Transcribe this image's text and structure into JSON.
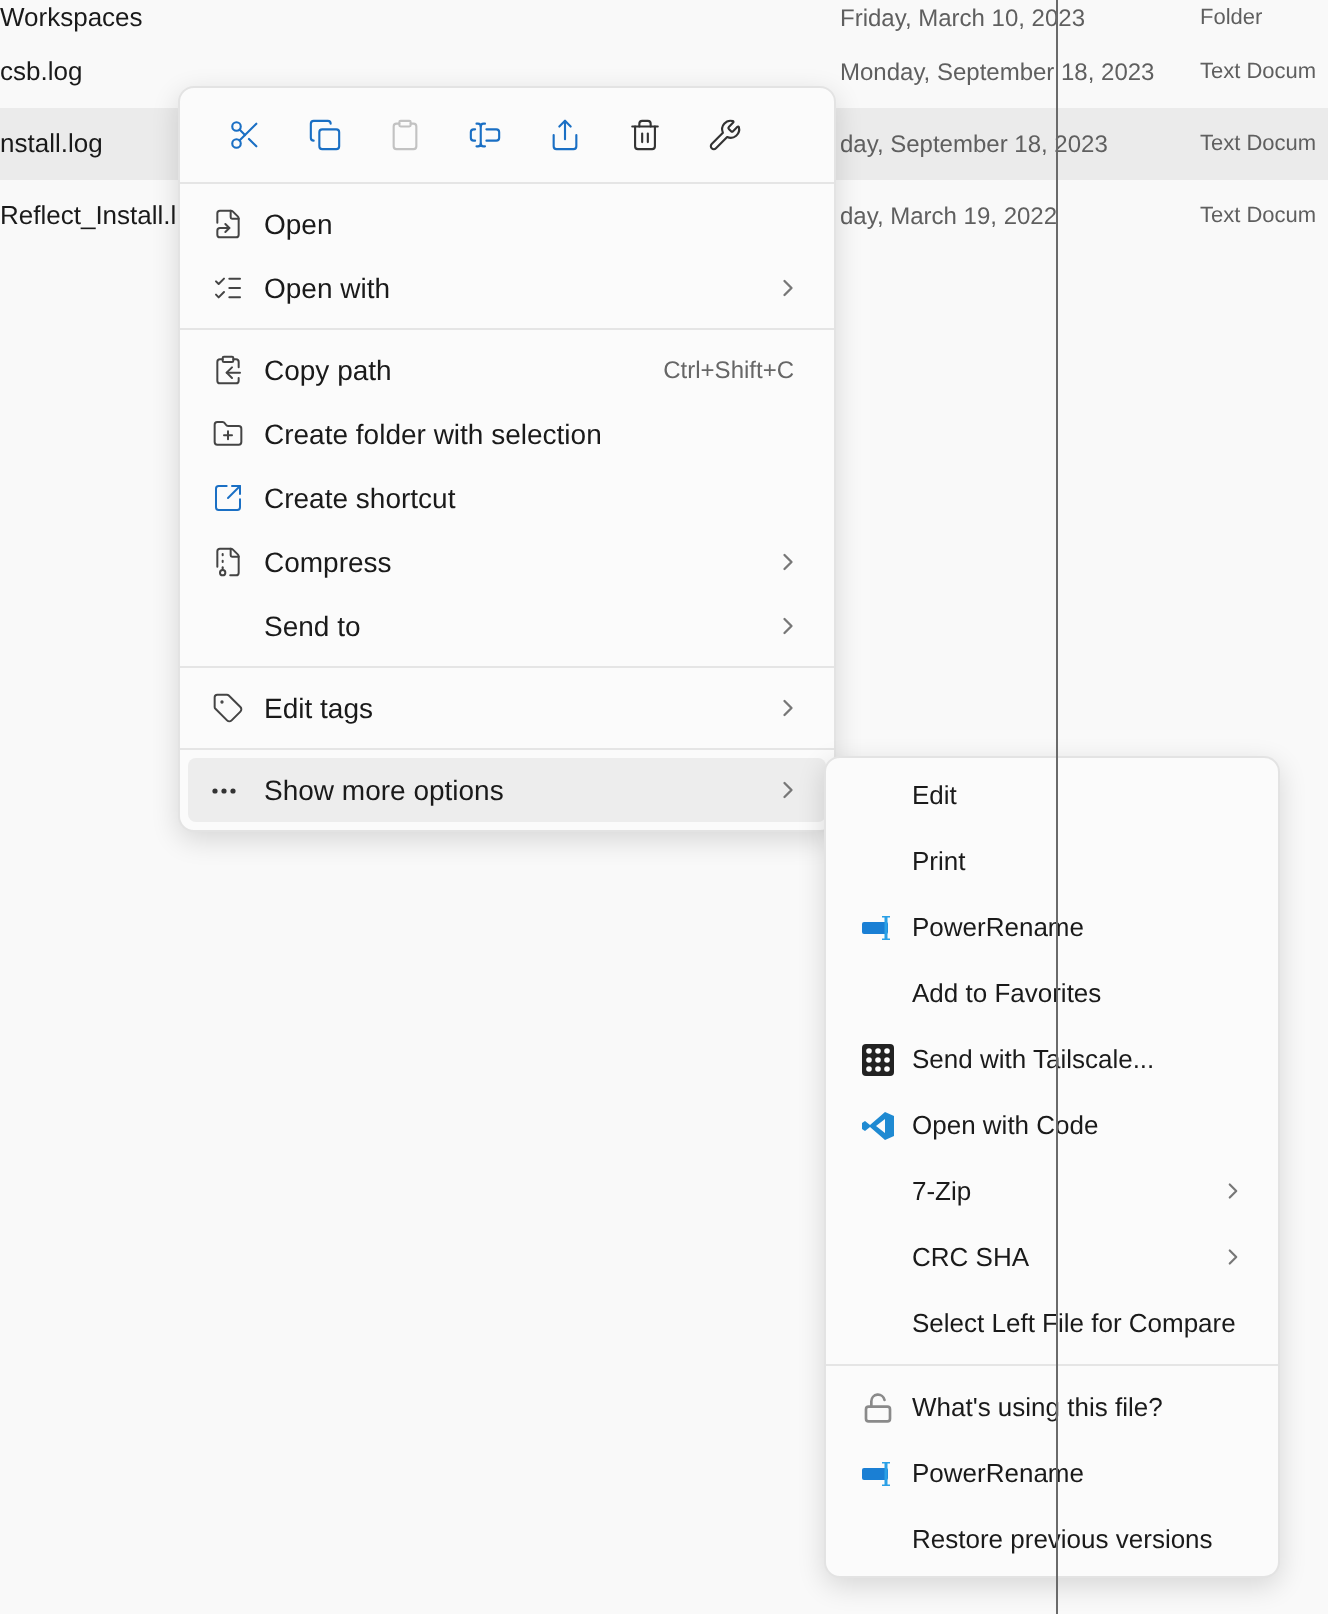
{
  "files": [
    {
      "name": "Workspaces",
      "date": "Friday, March 10, 2023",
      "type": "Folder",
      "selected": false
    },
    {
      "name": "csb.log",
      "date": "Monday, September 18, 2023",
      "type": "Text Docum",
      "selected": false
    },
    {
      "name": "nstall.log",
      "date": "day, September 18, 2023",
      "type": "Text Docum",
      "selected": true
    },
    {
      "name": "Reflect_Install.l",
      "date": "day, March 19, 2022",
      "type": "Text Docum",
      "selected": false
    }
  ],
  "context_menu": {
    "toolbar": [
      {
        "disabled": false
      },
      {
        "disabled": false
      },
      {
        "disabled": true
      },
      {
        "disabled": false
      },
      {
        "disabled": false
      },
      {
        "disabled": false
      },
      {
        "disabled": false
      }
    ],
    "items": [
      {
        "kind": "item",
        "label": "Open",
        "submenu": false,
        "selected": false
      },
      {
        "kind": "item",
        "label": "Open with",
        "submenu": true,
        "selected": false
      },
      {
        "kind": "separator"
      },
      {
        "kind": "item",
        "label": "Copy path",
        "shortcut": "Ctrl+Shift+C",
        "submenu": false,
        "selected": false
      },
      {
        "kind": "item",
        "label": "Create folder with selection",
        "submenu": false,
        "selected": false
      },
      {
        "kind": "item",
        "label": "Create shortcut",
        "submenu": false,
        "selected": false
      },
      {
        "kind": "item",
        "label": "Compress",
        "submenu": true,
        "selected": false
      },
      {
        "kind": "item",
        "label": "Send to",
        "submenu": true,
        "selected": false
      },
      {
        "kind": "separator"
      },
      {
        "kind": "item",
        "label": "Edit tags",
        "submenu": true,
        "selected": false
      },
      {
        "kind": "separator"
      },
      {
        "kind": "item",
        "label": "Show more options",
        "submenu": true,
        "selected": true
      }
    ]
  },
  "submenu": {
    "items": [
      {
        "kind": "item",
        "label": "Edit",
        "submenu": false
      },
      {
        "kind": "item",
        "label": "Print",
        "submenu": false
      },
      {
        "kind": "item",
        "label": "PowerRename",
        "submenu": false
      },
      {
        "kind": "item",
        "label": "Add to Favorites",
        "submenu": false
      },
      {
        "kind": "item",
        "label": "Send with Tailscale...",
        "submenu": false
      },
      {
        "kind": "item",
        "label": "Open with Code",
        "submenu": false
      },
      {
        "kind": "item",
        "label": "7-Zip",
        "submenu": true
      },
      {
        "kind": "item",
        "label": "CRC SHA",
        "submenu": true
      },
      {
        "kind": "item",
        "label": "Select Left File for Compare",
        "submenu": false
      },
      {
        "kind": "separator"
      },
      {
        "kind": "item",
        "label": "What's using this file?",
        "submenu": false
      },
      {
        "kind": "item",
        "label": "PowerRename",
        "submenu": false
      },
      {
        "kind": "item",
        "label": "Restore previous versions",
        "submenu": false
      }
    ]
  }
}
